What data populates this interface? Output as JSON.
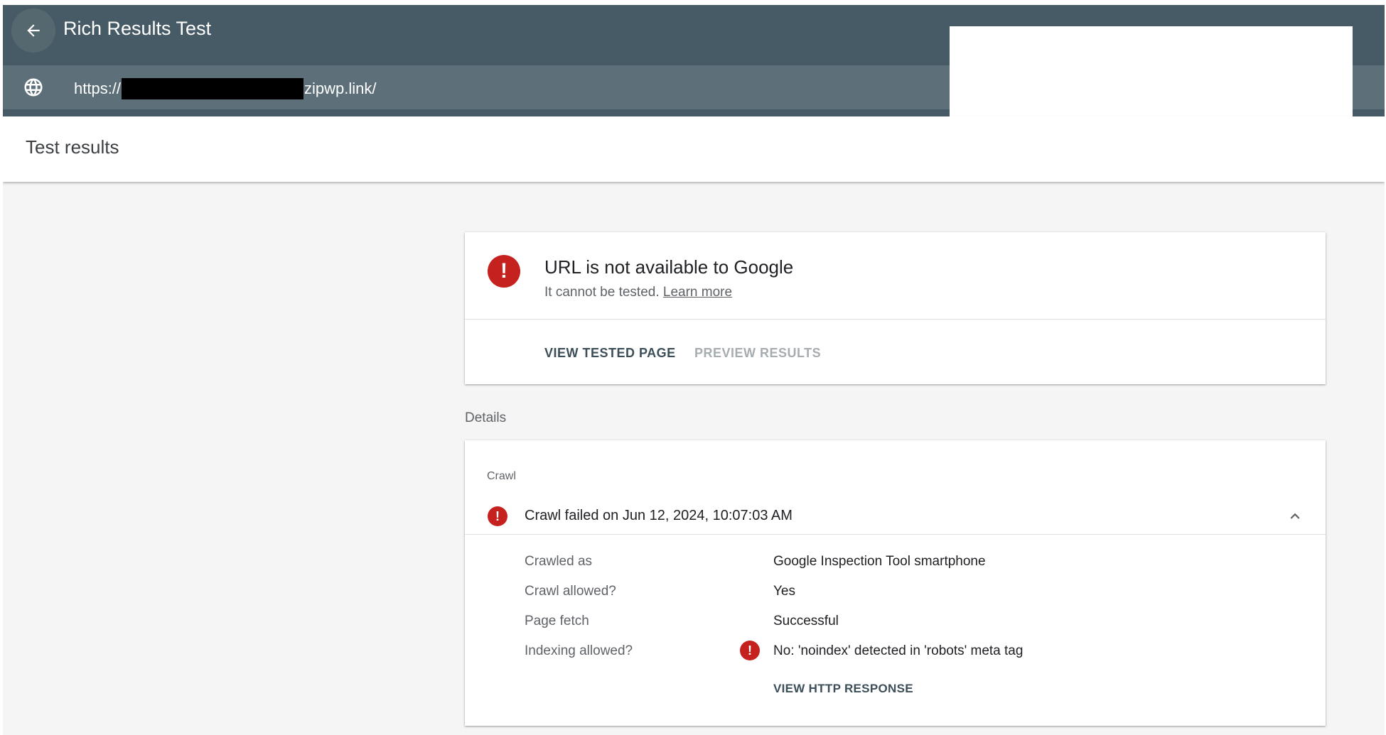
{
  "header": {
    "title": "Rich Results Test",
    "url_prefix": "https://",
    "url_suffix": "zipwp.link/"
  },
  "page": {
    "title": "Test results"
  },
  "status_card": {
    "title": "URL is not available to Google",
    "subtitle": "It cannot be tested.",
    "link": "Learn more",
    "actions": {
      "view_tested_page": "VIEW TESTED PAGE",
      "preview_results": "PREVIEW RESULTS"
    }
  },
  "details": {
    "label": "Details",
    "section": "Crawl",
    "crawl_status": "Crawl failed on Jun 12, 2024, 10:07:03 AM",
    "rows": [
      {
        "label": "Crawled as",
        "value": "Google Inspection Tool smartphone"
      },
      {
        "label": "Crawl allowed?",
        "value": "Yes"
      },
      {
        "label": "Page fetch",
        "value": "Successful"
      },
      {
        "label": "Indexing allowed?",
        "value": "No: 'noindex' detected in 'robots' meta tag"
      }
    ],
    "http_button": "VIEW HTTP RESPONSE"
  },
  "colors": {
    "header_bg": "#475b66",
    "url_bar_bg": "#5d7079",
    "error": "#c5221f",
    "page_bg": "#f5f5f5"
  },
  "icons": [
    "arrow-back-icon",
    "globe-icon",
    "error-icon",
    "chevron-up-icon"
  ]
}
